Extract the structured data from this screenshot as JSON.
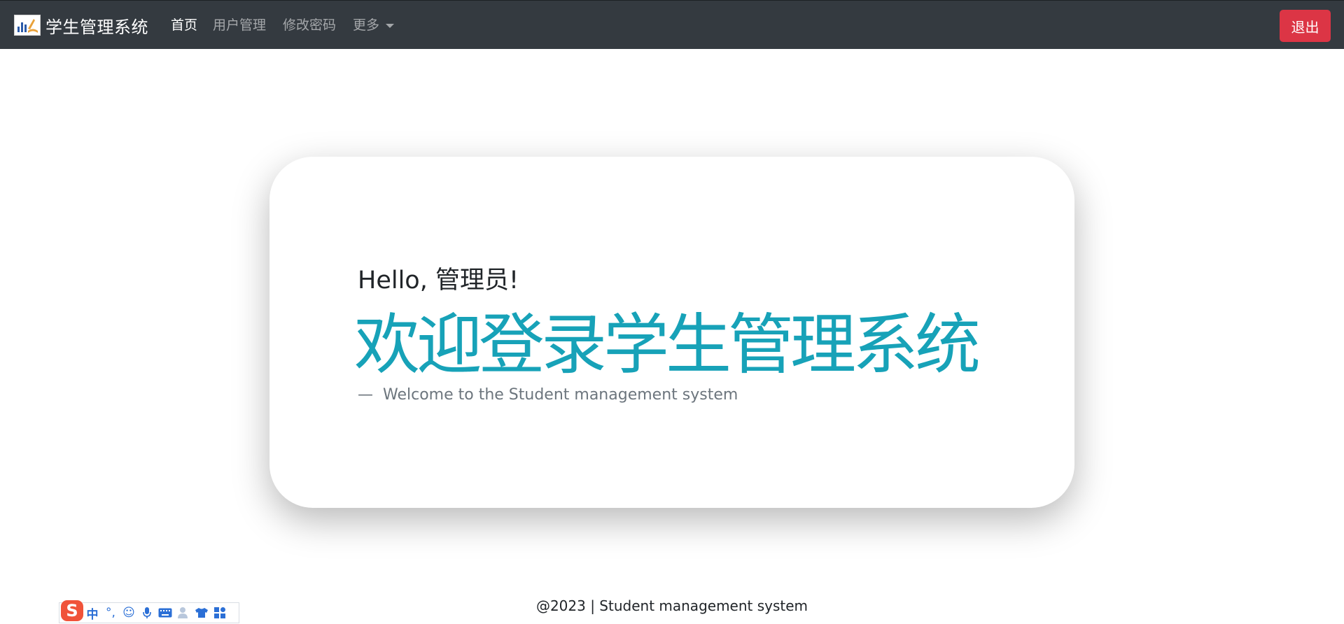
{
  "navbar": {
    "brand_title": "学生管理系统",
    "links": [
      {
        "label": "首页",
        "active": true
      },
      {
        "label": "用户管理",
        "active": false
      },
      {
        "label": "修改密码",
        "active": false
      },
      {
        "label": "更多",
        "active": false
      }
    ],
    "logout_label": "退出"
  },
  "hero": {
    "greeting": "Hello, 管理员!",
    "welcome_title": "欢迎登录学生管理系统",
    "subtitle_dash": "—",
    "subtitle": "Welcome to the Student management system"
  },
  "footer": {
    "text": "@2023 | Student management system"
  },
  "ime_toolbar": {
    "logo_letter": "S",
    "mode_label": "中",
    "punct_label": "°,",
    "emoji_glyph": "☺",
    "icons": [
      "sogou-logo-icon",
      "chinese-mode-icon",
      "punctuation-icon",
      "emoji-icon",
      "microphone-icon",
      "keyboard-icon",
      "user-icon",
      "skin-shirt-icon",
      "toolbox-grid-icon"
    ]
  },
  "colors": {
    "navbar_bg": "#343a40",
    "accent_info": "#17a2b8",
    "danger": "#dc3545",
    "muted": "#6c757d"
  }
}
